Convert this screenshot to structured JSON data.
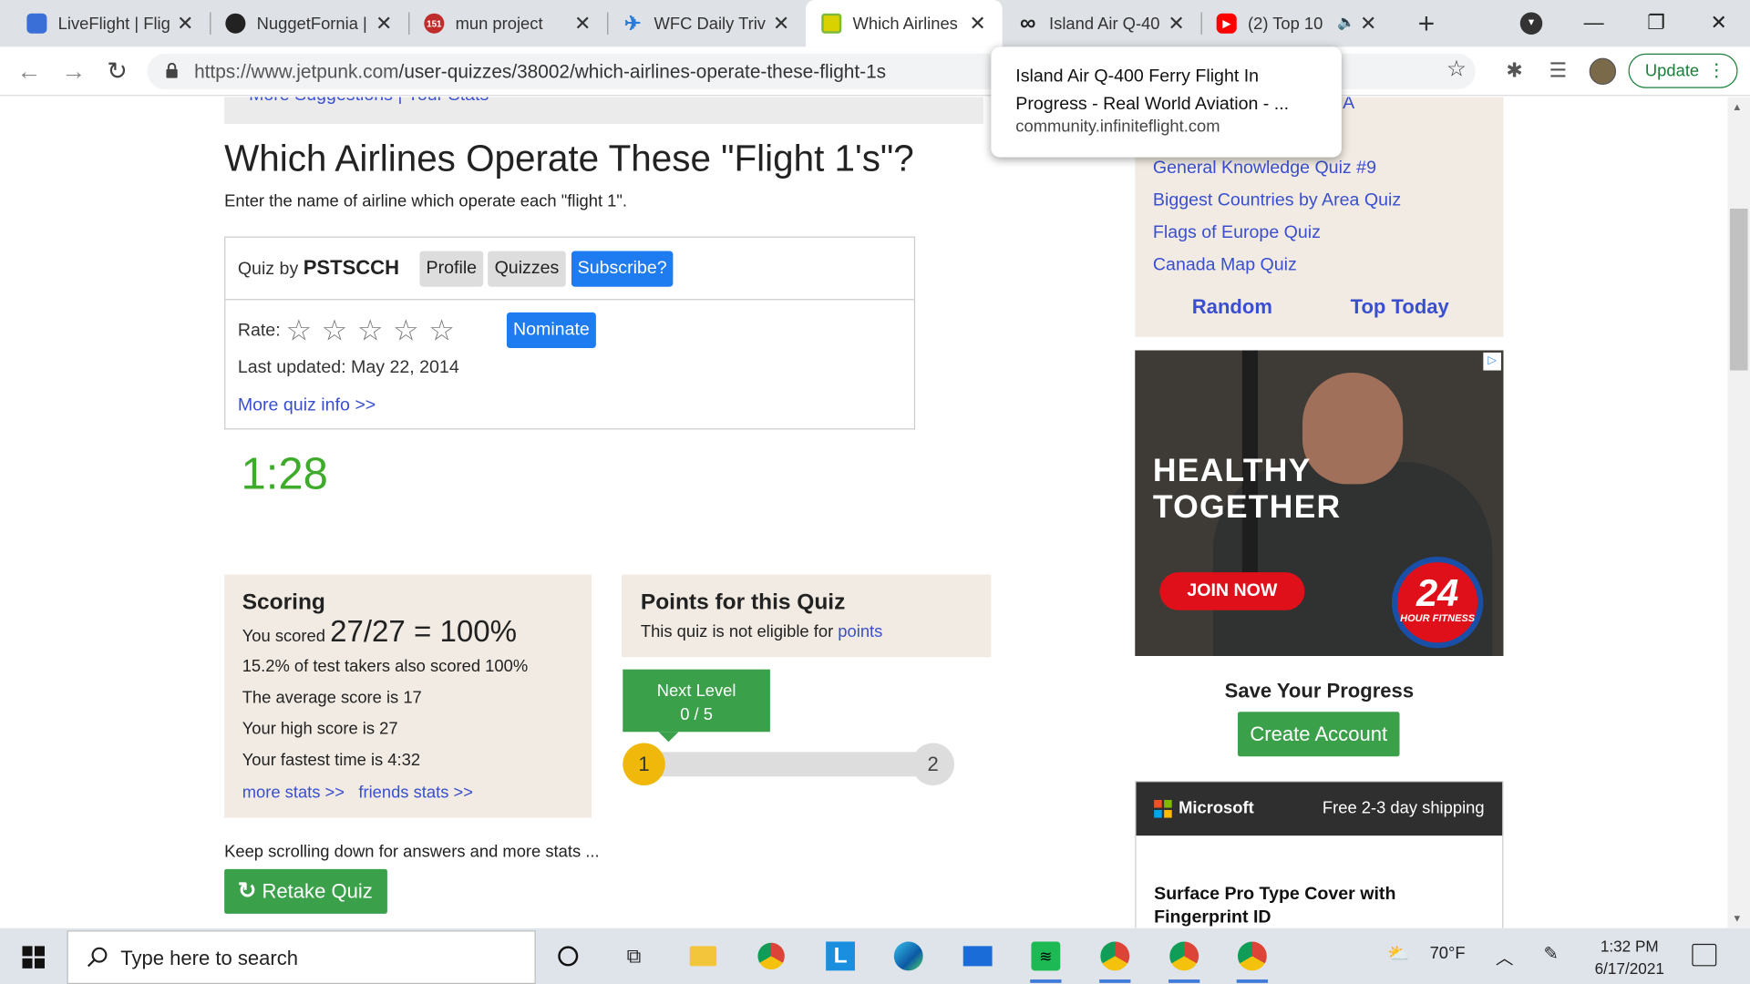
{
  "browser": {
    "tabs": [
      {
        "title": "LiveFlight | Fligh",
        "icon": "liveflight-icon",
        "color": "#3b6fd8"
      },
      {
        "title": "NuggetFornia |",
        "icon": "nuggetfornia-icon",
        "color": "#222222"
      },
      {
        "title": "mun project",
        "icon": "mun-icon",
        "color": "#c02c2c",
        "badge": "151"
      },
      {
        "title": "WFC Daily Trivia",
        "icon": "airplane-icon",
        "color": "#2a7bd8"
      },
      {
        "title": "Which Airlines",
        "icon": "jetpunk-icon",
        "color": "#7dba3c"
      },
      {
        "title": "Island Air Q-40",
        "icon": "infinite-icon",
        "color": "#222222"
      },
      {
        "title": "(2) Top 10",
        "icon": "youtube-icon",
        "color": "#ff0000"
      }
    ],
    "url_host": "https://www.jetpunk.com",
    "url_path": "/user-quizzes/38002/which-airlines-operate-these-flight-1s",
    "update_label": "Update"
  },
  "tooltip": {
    "title": "Island Air Q-400 Ferry Flight In Progress - Real World Aviation - ...",
    "url": "community.infiniteflight.com"
  },
  "page": {
    "top_links": "More Suggestions | Your Stats",
    "title": "Which Airlines Operate These \"Flight 1's\"?",
    "description": "Enter the name of airline which operate each \"flight 1\".",
    "quiz_by_label": "Quiz by",
    "author": "PSTSCCH",
    "profile_btn": "Profile",
    "quizzes_btn": "Quizzes",
    "subscribe_btn": "Subscribe?",
    "rate_label": "Rate:",
    "rating_stars": 0,
    "nominate_btn": "Nominate",
    "last_updated": "Last updated: May 22, 2014",
    "more_info": "More quiz info >>",
    "timer": "1:28",
    "scoring": {
      "title": "Scoring",
      "you_scored": "You scored",
      "score": "27/27 = 100%",
      "pct_line": "15.2% of test takers also scored 100%",
      "avg_line": "The average score is 17",
      "high_line": "Your high score is 27",
      "fast_line": "Your fastest time is 4:32",
      "more_stats": "more stats >>",
      "friends_stats": "friends stats >>"
    },
    "points": {
      "title": "Points for this Quiz",
      "text": "This quiz is not eligible for",
      "link": "points"
    },
    "level": {
      "next_label": "Next Level",
      "progress_text": "0 / 5",
      "progress_fraction": 0,
      "current": "1",
      "next": "2"
    },
    "keep_scrolling": "Keep scrolling down for answers and more stats ...",
    "retake": "Retake Quiz"
  },
  "sidebar": {
    "partial_link": "A",
    "links": [
      "General Knowledge Quiz #9",
      "Biggest Countries by Area Quiz",
      "Flags of Europe Quiz",
      "Canada Map Quiz"
    ],
    "random": "Random",
    "top_today": "Top Today",
    "ad_headline": "HEALTHY TOGETHER",
    "ad_cta": "JOIN NOW",
    "ad_logo": "24",
    "ad_logo_sub": "HOUR FITNESS",
    "save_progress": "Save Your Progress",
    "create_account": "Create Account",
    "ms_brand": "Microsoft",
    "ms_shipping": "Free 2-3 day shipping",
    "ms_product": "Surface Pro Type Cover with Fingerprint ID"
  },
  "taskbar": {
    "search_placeholder": "Type here to search",
    "weather": "70°F",
    "time": "1:32 PM",
    "date": "6/17/2021"
  }
}
